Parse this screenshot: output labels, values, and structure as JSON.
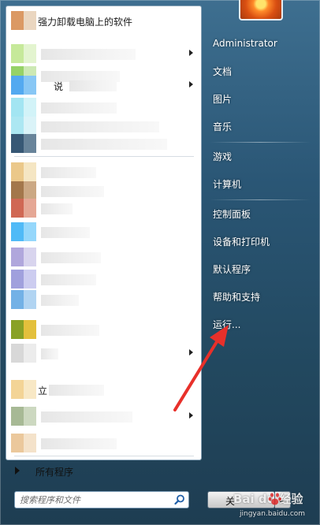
{
  "start_menu": {
    "pinned_program_label": "强力卸载电脑上的软件",
    "partial_label_1": "说",
    "partial_label_2": "立",
    "all_programs_label": "所有程序",
    "search": {
      "placeholder": "搜索程序和文件"
    }
  },
  "right_pane": {
    "items": [
      {
        "label": "Administrator"
      },
      {
        "label": "文档"
      },
      {
        "label": "图片"
      },
      {
        "label": "音乐"
      },
      {
        "label": "游戏"
      },
      {
        "label": "计算机"
      },
      {
        "label": "控制面板"
      },
      {
        "label": "设备和打印机"
      },
      {
        "label": "默认程序"
      },
      {
        "label": "帮助和支持"
      },
      {
        "label": "运行..."
      }
    ],
    "shutdown_label": "关"
  },
  "watermark": {
    "logo": "Bai du 经验",
    "url": "jingyan.baidu.com"
  },
  "colors": {
    "frame": "#2a5675",
    "annotation": "#e8302a",
    "right_text": "#ffffff"
  }
}
